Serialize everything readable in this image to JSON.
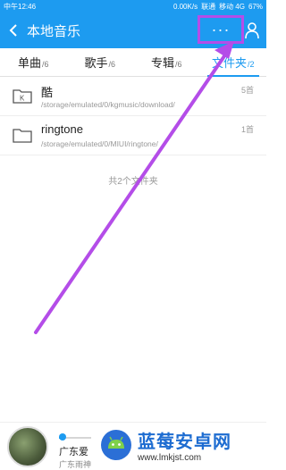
{
  "status_bar": {
    "left": "中午12:46",
    "speed": "0.00K/s",
    "carrier1": "联通",
    "carrier2": "移动 4G",
    "battery": "67%"
  },
  "app_bar": {
    "title": "本地音乐",
    "more_label": "···"
  },
  "tabs": [
    {
      "label": "单曲",
      "count": "/6"
    },
    {
      "label": "歌手",
      "count": "/6"
    },
    {
      "label": "专辑",
      "count": "/6"
    },
    {
      "label": "文件夹",
      "count": "/2"
    }
  ],
  "folders": [
    {
      "name": "酷",
      "path": "/storage/emulated/0/kgmusic/download/",
      "count": "5首",
      "icon": "kugou-folder-icon"
    },
    {
      "name": "ringtone",
      "path": "/storage/emulated/0/MIUI/ringtone/",
      "count": "1首",
      "icon": "folder-icon"
    }
  ],
  "footer_note": "共2个文件夹",
  "player": {
    "song": "广东爱",
    "artist": "广东雨神",
    "progress": 0.15
  },
  "watermark": {
    "title": "蓝莓安卓网",
    "url": "www.lmkjst.com"
  },
  "colors": {
    "accent": "#1d9bf0",
    "highlight": "#b44de8"
  }
}
